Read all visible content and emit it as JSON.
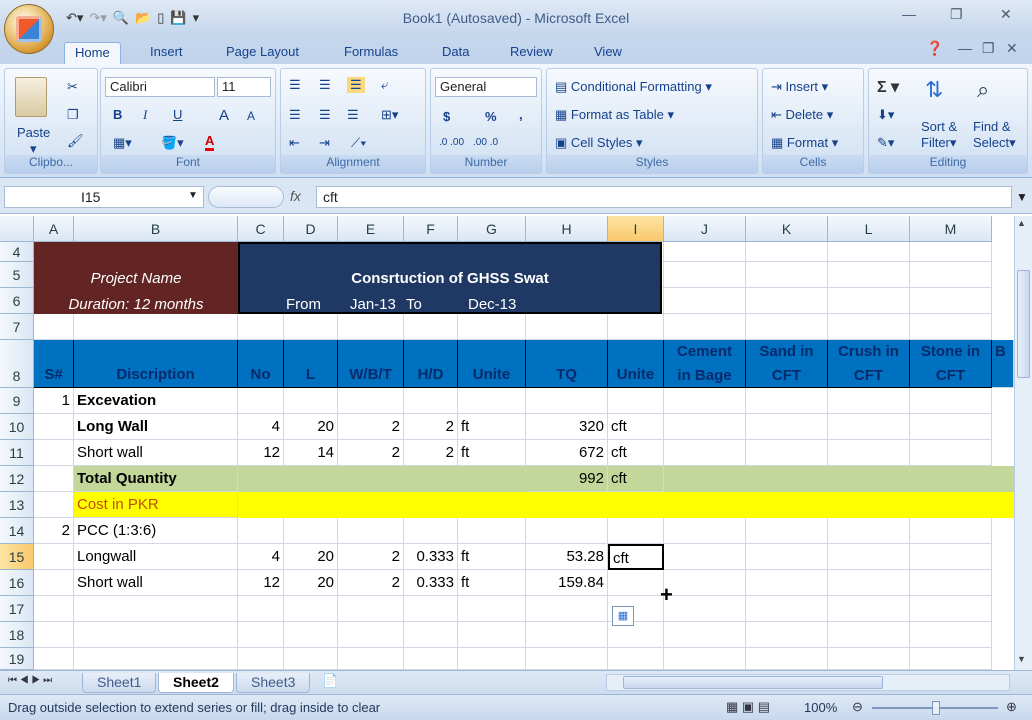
{
  "window": {
    "title": "Book1 (Autosaved) - Microsoft Excel"
  },
  "tabs": [
    "Home",
    "Insert",
    "Page Layout",
    "Formulas",
    "Data",
    "Review",
    "View"
  ],
  "ribbon": {
    "clipboard": {
      "paste": "Paste",
      "label": "Clipbo..."
    },
    "font": {
      "name": "Calibri",
      "size": "11",
      "label": "Font",
      "bold": "B",
      "italic": "I",
      "underline": "U",
      "grow": "A",
      "shrink": "A",
      "font_color": "A"
    },
    "alignment": {
      "label": "Alignment"
    },
    "number": {
      "format": "General",
      "currency": "$",
      "percent": "%",
      "comma": ",",
      "inc": ".0 .00",
      "dec": ".00 .0",
      "label": "Number"
    },
    "styles": {
      "cond": "Conditional Formatting",
      "table": "Format as Table",
      "cell": "Cell Styles",
      "label": "Styles"
    },
    "cells": {
      "insert": "Insert",
      "delete": "Delete",
      "format": "Format",
      "label": "Cells"
    },
    "editing": {
      "sigma": "Σ",
      "sort": "Sort &",
      "sort2": "Filter",
      "find": "Find &",
      "find2": "Select",
      "label": "Editing"
    }
  },
  "formula_bar": {
    "name_box": "I15",
    "fx": "fx",
    "content": "cft"
  },
  "columns": [
    "A",
    "B",
    "C",
    "D",
    "E",
    "F",
    "G",
    "H",
    "I",
    "J",
    "K",
    "L",
    "M"
  ],
  "rows": [
    "4",
    "5",
    "6",
    "7",
    "8",
    "9",
    "10",
    "11",
    "12",
    "13",
    "14",
    "15",
    "16",
    "17",
    "18",
    "19"
  ],
  "banner": {
    "project": "Project Name",
    "duration": "Duration: 12 months",
    "title": "Consrtuction of GHSS Swat",
    "from_label": "From",
    "from": "Jan-13",
    "to_label": "To",
    "to": "Dec-13"
  },
  "header": {
    "s": "S#",
    "desc": "Discription",
    "no": "No",
    "l": "L",
    "wbt": "W/B/T",
    "hd": "H/D",
    "unite": "Unite",
    "tq": "TQ",
    "unite2": "Unite",
    "cement1": "Cement",
    "cement2": "in Bage",
    "sand1": "Sand in",
    "sand2": "CFT",
    "crush1": "Crush in",
    "crush2": "CFT",
    "stone1": "Stone in",
    "stone2": "CFT",
    "b": "B"
  },
  "data": {
    "r9": {
      "s": "1",
      "desc": "Excevation"
    },
    "r10": {
      "desc": "Long Wall",
      "no": "4",
      "l": "20",
      "wbt": "2",
      "hd": "2",
      "unite": "ft",
      "tq": "320",
      "unite2": "cft"
    },
    "r11": {
      "desc": "Short wall",
      "no": "12",
      "l": "14",
      "wbt": "2",
      "hd": "2",
      "unite": "ft",
      "tq": "672",
      "unite2": "cft"
    },
    "r12": {
      "desc": "Total Quantity",
      "tq": "992",
      "unite2": "cft"
    },
    "r13": {
      "desc": "Cost in PKR"
    },
    "r14": {
      "s": "2",
      "desc": "PCC (1:3:6)"
    },
    "r15": {
      "desc": "Longwall",
      "no": "4",
      "l": "20",
      "wbt": "2",
      "hd": "0.333",
      "unite": "ft",
      "tq": "53.28",
      "unite2": "cft"
    },
    "r16": {
      "desc": "Short wall",
      "no": "12",
      "l": "20",
      "wbt": "2",
      "hd": "0.333",
      "unite": "ft",
      "tq": "159.84"
    }
  },
  "sheets": [
    "Sheet1",
    "Sheet2",
    "Sheet3"
  ],
  "status": {
    "text": "Drag outside selection to extend series or fill; drag inside to clear",
    "zoom": "100%"
  },
  "colors": {
    "banner_left": "#632523",
    "banner_right": "#1f3864",
    "header_blue": "#0070c0",
    "total_green": "#c4d79b",
    "cost_yellow": "#ffff00"
  }
}
